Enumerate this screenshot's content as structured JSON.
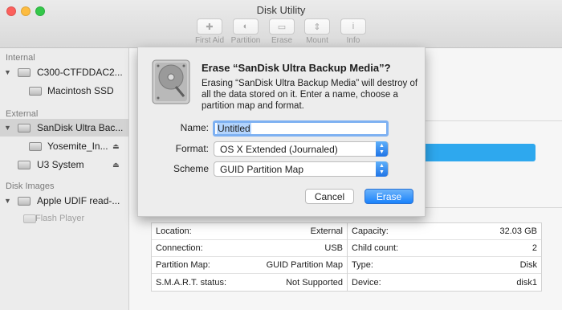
{
  "window": {
    "title": "Disk Utility"
  },
  "toolbar": [
    {
      "label": "First Aid",
      "icon": "stethoscope-icon",
      "glyph": "✚"
    },
    {
      "label": "Partition",
      "icon": "partition-icon",
      "glyph": "◐"
    },
    {
      "label": "Erase",
      "icon": "erase-icon",
      "glyph": "▭"
    },
    {
      "label": "Mount",
      "icon": "mount-icon",
      "glyph": "⇕"
    },
    {
      "label": "Info",
      "icon": "info-icon",
      "glyph": "i"
    }
  ],
  "sidebar": {
    "internal_label": "Internal",
    "external_label": "External",
    "images_label": "Disk Images",
    "items": [
      {
        "name": "C300-CTFDDAC2..."
      },
      {
        "name": "Macintosh SSD"
      },
      {
        "name": "SanDisk Ultra Bac..."
      },
      {
        "name": "Yosemite_In..."
      },
      {
        "name": "U3 System"
      },
      {
        "name": "Apple UDIF read-..."
      },
      {
        "name": "Flash Player"
      }
    ]
  },
  "sheet": {
    "title": "Erase “SanDisk Ultra Backup Media”?",
    "message": "Erasing “SanDisk Ultra Backup Media” will destroy of all the data stored on it. Enter a name, choose a partition map and format.",
    "name_label": "Name:",
    "name_value": "Untitled",
    "format_label": "Format:",
    "format_value": "OS X Extended (Journaled)",
    "scheme_label": "Scheme",
    "scheme_value": "GUID Partition Map",
    "cancel_label": "Cancel",
    "erase_label": "Erase"
  },
  "info": {
    "left": [
      {
        "k": "Location:",
        "v": "External"
      },
      {
        "k": "Connection:",
        "v": "USB"
      },
      {
        "k": "Partition Map:",
        "v": "GUID Partition Map"
      },
      {
        "k": "S.M.A.R.T. status:",
        "v": "Not Supported"
      }
    ],
    "right": [
      {
        "k": "Capacity:",
        "v": "32.03 GB"
      },
      {
        "k": "Child count:",
        "v": "2"
      },
      {
        "k": "Type:",
        "v": "Disk"
      },
      {
        "k": "Device:",
        "v": "disk1"
      }
    ]
  },
  "colors": {
    "accent": "#1a82fb",
    "selection": "#d3d3d3",
    "progress": "#2ea8ee"
  }
}
